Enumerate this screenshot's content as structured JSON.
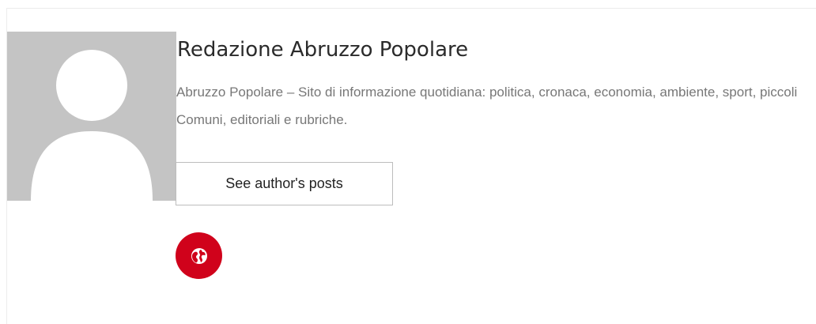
{
  "author": {
    "name": "Redazione Abruzzo Popolare",
    "bio": "Abruzzo Popolare – Sito di informazione quotidiana: politica, cronaca, economia, ambiente, sport, piccoli Comuni, editoriali e rubriche.",
    "posts_button_label": "See author's posts",
    "avatar_icon": "default-user-avatar",
    "website_icon": "globe-icon"
  },
  "colors": {
    "accent": "#d0021b",
    "avatar_bg": "#c4c4c4",
    "avatar_fg": "#ffffff"
  }
}
